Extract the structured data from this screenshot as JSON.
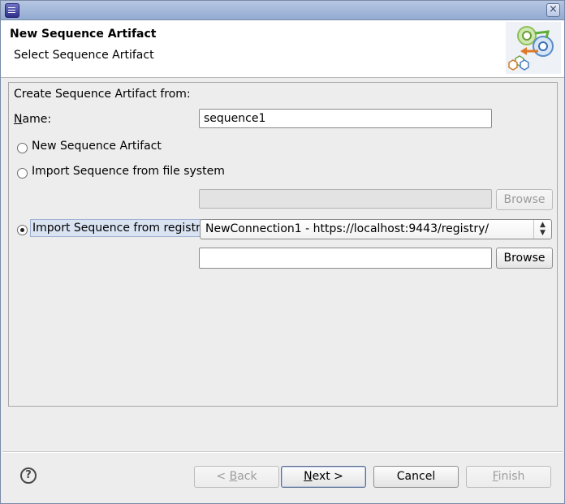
{
  "window": {
    "close_glyph": "×"
  },
  "header": {
    "title": "New Sequence Artifact",
    "subtitle": "Select Sequence Artifact"
  },
  "form": {
    "group_label": "Create Sequence Artifact from:",
    "name_label_mnemonic": "N",
    "name_label_rest": "ame:",
    "name_value": "sequence1",
    "options": [
      {
        "label": "New Sequence Artifact",
        "selected": false
      },
      {
        "label": "Import Sequence from file system",
        "selected": false
      },
      {
        "label": "Import Sequence from registry",
        "selected": true
      }
    ],
    "file_path_value": "",
    "file_browse_label": "Browse",
    "registry_connection": "NewConnection1 - https://localhost:9443/registry/",
    "registry_path_value": "",
    "registry_browse_label": "Browse"
  },
  "footer": {
    "help_glyph": "?",
    "back_prefix": "< ",
    "back_mnemonic": "B",
    "back_rest": "ack",
    "next_mnemonic": "N",
    "next_rest": "ext >",
    "cancel_label": "Cancel",
    "finish_mnemonic": "F",
    "finish_rest": "inish"
  },
  "colors": {
    "title_bar": "#a9bcdf",
    "header_bg": "#ffffff",
    "dialog_bg": "#ededed"
  }
}
